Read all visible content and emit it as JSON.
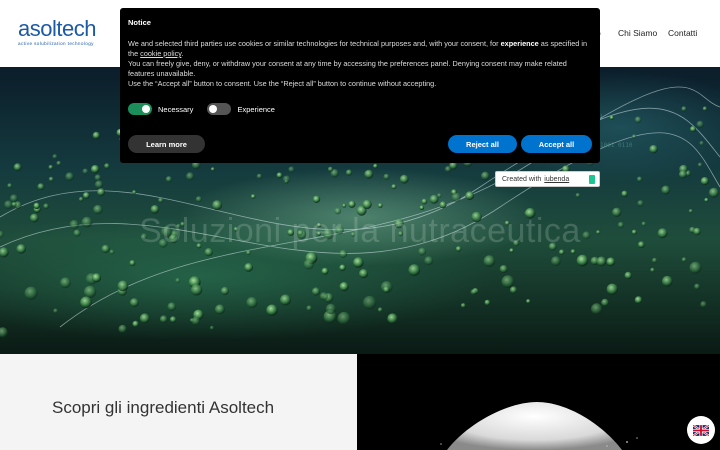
{
  "header": {
    "logo_text": "asoltech",
    "logo_tagline": "active solubilization technology",
    "nav_partial": "o",
    "nav_chi_siamo": "Chi Siamo",
    "nav_contatti": "Contatti"
  },
  "hero": {
    "title": "Soluzioni per la nutraceutica"
  },
  "section": {
    "title": "Scopri gli ingredienti Asoltech"
  },
  "notice": {
    "title": "Notice",
    "body_1": "We and selected third parties use cookies or similar technologies for technical purposes and, with your consent, for ",
    "body_1_bold": "experience",
    "body_1_end": " as specified in the ",
    "cookie_policy": "cookie policy",
    "body_1_tail": ".",
    "body_2": "You can freely give, deny, or withdraw your consent at any time by accessing the preferences panel. Denying consent may make related features unavailable.",
    "body_3": "Use the “Accept all” button to consent. Use the “Reject all” button to continue without accepting.",
    "toggle_necessary": "Necessary",
    "toggle_experience": "Experience",
    "learn_more": "Learn more",
    "reject_all": "Reject all",
    "accept_all": "Accept all"
  },
  "badge": {
    "created_with": "Created with",
    "brand": "iubenda"
  },
  "colors": {
    "accent": "#0073ce",
    "toggle_on": "#1b8e5a",
    "logo": "#1d5aa6"
  },
  "icons": {
    "language": "uk-flag-icon",
    "badge": "iubenda-icon"
  }
}
